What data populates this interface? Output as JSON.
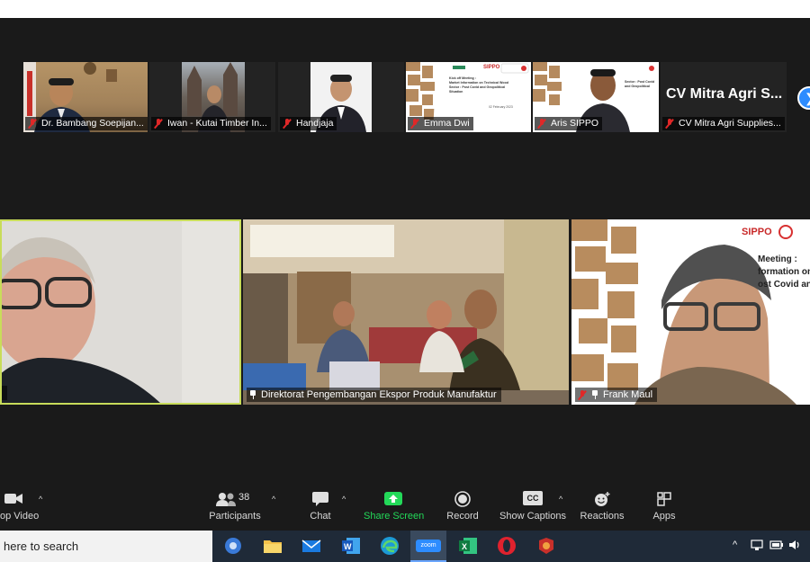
{
  "thumbnails": [
    {
      "name": "Dr. Bambang Soepijan...",
      "muted": true
    },
    {
      "name": "Iwan - Kutai Timber In...",
      "muted": true
    },
    {
      "name": "Handjaja",
      "muted": true
    },
    {
      "name": "Emma Dwi",
      "muted": true
    },
    {
      "name": "Aris SIPPO",
      "muted": true
    },
    {
      "name": "CV Mitra Agri Supplies...",
      "muted": true
    }
  ],
  "text_tile_heading": "CV Mitra Agri S...",
  "slide": {
    "title_lines": [
      "Kick off Meeting :",
      "Market Information on Technical Wood",
      "Sector : Post Covid and Geopolitical",
      "Situation"
    ],
    "date": "02 February 2023",
    "brand": "SIPPO",
    "big_lines": [
      "Meeting :",
      "formation on",
      "ost Covid and"
    ]
  },
  "tiles": [
    {
      "name": "",
      "active_speaker": true
    },
    {
      "name": "Direktorat Pengembangan Ekspor Produk Manufaktur",
      "pinned": true
    },
    {
      "name": "Frank Maul",
      "muted": true,
      "pinned": true
    }
  ],
  "toolbar": {
    "video_label": "op Video",
    "participants_label": "Participants",
    "participants_count": "38",
    "chat_label": "Chat",
    "share_label": "Share Screen",
    "record_label": "Record",
    "captions_label": "Show Captions",
    "captions_badge": "CC",
    "reactions_label": "Reactions",
    "apps_label": "Apps"
  },
  "taskbar": {
    "search_text": "here to search",
    "zoom_icon_text": "zoom"
  },
  "colors": {
    "active_speaker_border": "#c8dc5a",
    "share_green": "#23d959",
    "mute_red": "#e02828",
    "zoom_blue": "#2d8cff"
  }
}
